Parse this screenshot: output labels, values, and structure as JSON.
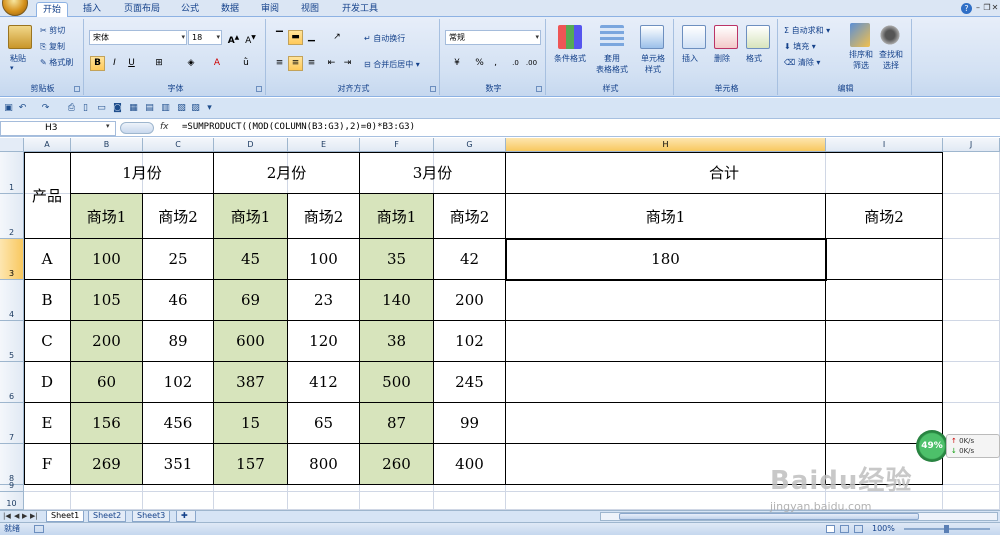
{
  "ribbon_tabs": [
    "开始",
    "插入",
    "页面布局",
    "公式",
    "数据",
    "审阅",
    "视图",
    "开发工具"
  ],
  "active_tab": "开始",
  "clipboard": {
    "paste": "粘贴",
    "cut": "剪切",
    "copy": "复制",
    "format_painter": "格式刷",
    "group": "剪贴板"
  },
  "font": {
    "name": "宋体",
    "size": "18",
    "group": "字体"
  },
  "alignment": {
    "wrap": "自动换行",
    "merge": "合并后居中",
    "group": "对齐方式"
  },
  "number": {
    "format": "常规",
    "group": "数字"
  },
  "styles": {
    "cond": "条件格式",
    "table": "套用\n表格格式",
    "cell": "单元格\n样式",
    "group": "样式"
  },
  "cells": {
    "insert": "插入",
    "delete": "删除",
    "format": "格式",
    "group": "单元格"
  },
  "editing": {
    "autosum": "自动求和",
    "fill": "填充",
    "clear": "清除",
    "sort": "排序和\n筛选",
    "find": "查找和\n选择",
    "group": "编辑"
  },
  "name_box": "H3",
  "formula": "=SUMPRODUCT((MOD(COLUMN(B3:G3),2)=0)*B3:G3)",
  "columns": [
    "A",
    "B",
    "C",
    "D",
    "E",
    "F",
    "G",
    "H",
    "I",
    "J"
  ],
  "rows": [
    "1",
    "2",
    "3",
    "4",
    "5",
    "6",
    "7",
    "8",
    "9",
    "10"
  ],
  "table": {
    "product_header": "产品",
    "months": [
      "1月份",
      "2月份",
      "3月份"
    ],
    "total_header": "合计",
    "stores": [
      "商场1",
      "商场2",
      "商场1",
      "商场2",
      "商场1",
      "商场2"
    ],
    "total_stores": [
      "商场1",
      "商场2"
    ],
    "products": [
      "A",
      "B",
      "C",
      "D",
      "E",
      "F"
    ],
    "values": [
      [
        "100",
        "25",
        "45",
        "100",
        "35",
        "42"
      ],
      [
        "105",
        "46",
        "69",
        "23",
        "140",
        "200"
      ],
      [
        "200",
        "89",
        "600",
        "120",
        "38",
        "102"
      ],
      [
        "60",
        "102",
        "387",
        "412",
        "500",
        "245"
      ],
      [
        "156",
        "456",
        "15",
        "65",
        "87",
        "99"
      ],
      [
        "269",
        "351",
        "157",
        "800",
        "260",
        "400"
      ]
    ],
    "h3_value": "180"
  },
  "sheet_tabs": [
    "Sheet1",
    "Sheet2",
    "Sheet3"
  ],
  "status": {
    "mode": "就绪",
    "zoom": "100%"
  },
  "watermark": {
    "main": "Baidu经验",
    "sub": "jingyan.baidu.com"
  },
  "net": {
    "percent": "49%",
    "up": "0K/s",
    "down": "0K/s"
  }
}
